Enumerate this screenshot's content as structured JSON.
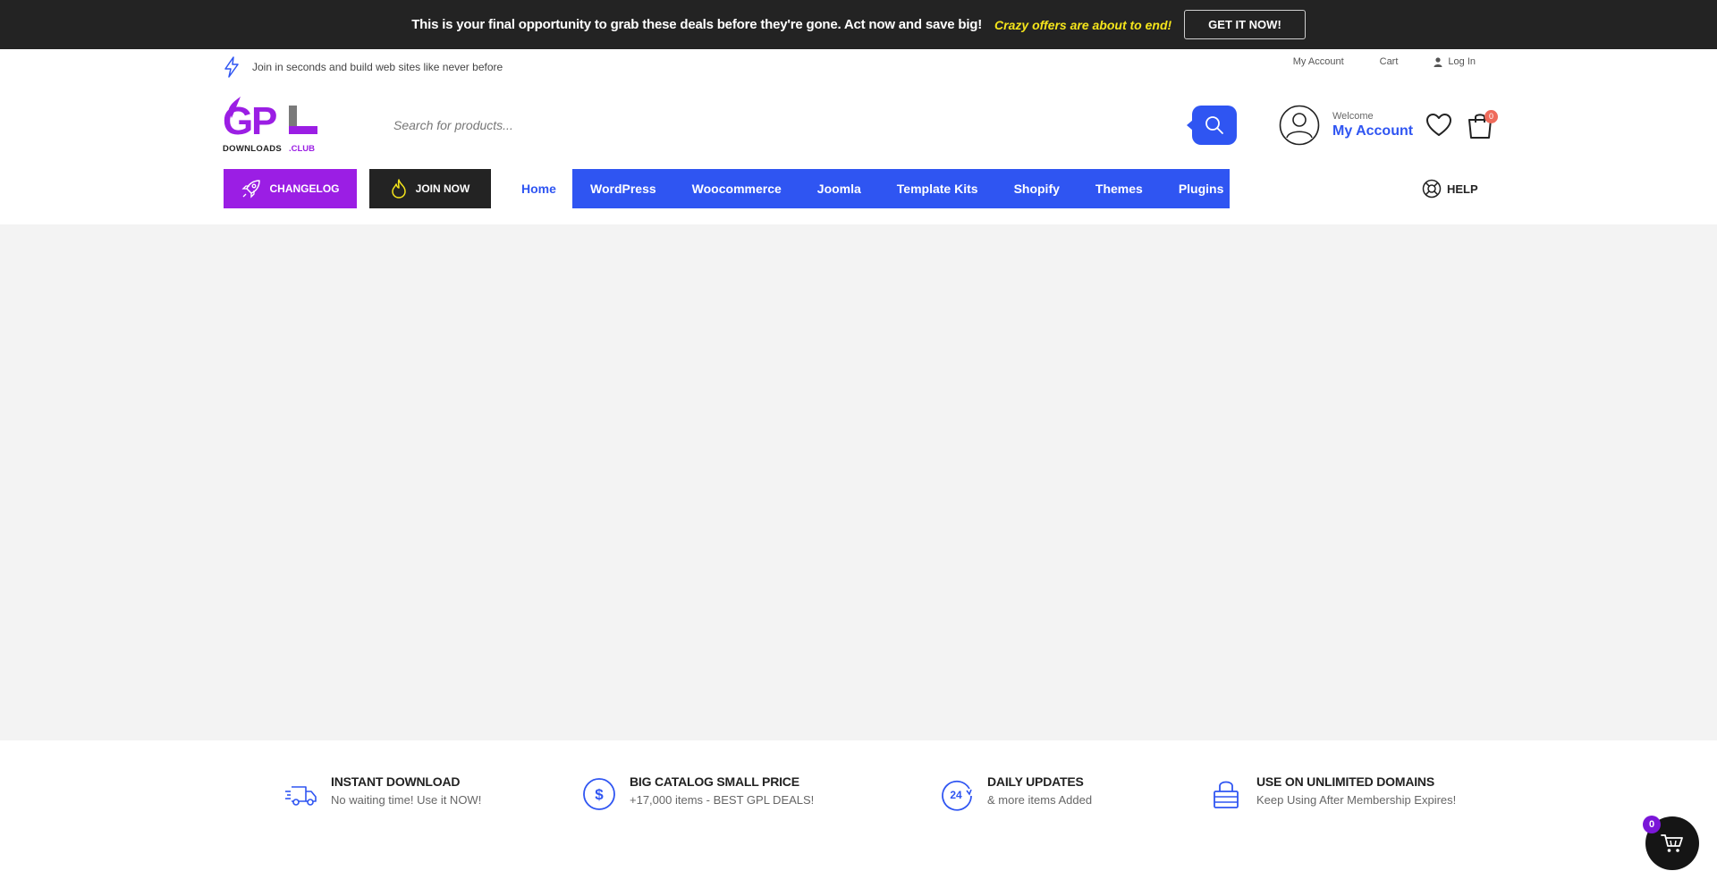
{
  "promo": {
    "message": "This is your final opportunity to grab these deals before they're gone. Act now and save big!",
    "highlight": "Crazy offers are about to end!",
    "cta_label": "GET IT NOW!"
  },
  "utility": {
    "tagline": "Join in seconds and build web sites like never before",
    "my_account": "My Account",
    "cart": "Cart",
    "log_in": "Log In"
  },
  "logo": {
    "main": "GPL",
    "sub": "DOWNLOADS",
    "suffix": ".CLUB"
  },
  "search": {
    "placeholder": "Search for products..."
  },
  "account": {
    "welcome": "Welcome",
    "name": "My Account"
  },
  "cart_count": "0",
  "nav": {
    "changelog": "CHANGELOG",
    "join_now": "JOIN NOW",
    "home": "Home",
    "items": [
      "WordPress",
      "Woocommerce",
      "Joomla",
      "Template Kits",
      "Shopify",
      "Themes",
      "Plugins"
    ],
    "help": "HELP"
  },
  "features": [
    {
      "title": "INSTANT DOWNLOAD",
      "subtitle": "No waiting time! Use it NOW!",
      "icon": "delivery-truck-icon"
    },
    {
      "title": "BIG CATALOG SMALL PRICE",
      "subtitle": "+17,000 items - BEST GPL DEALS!",
      "icon": "dollar-coin-icon"
    },
    {
      "title": "DAILY UPDATES",
      "subtitle": "& more items Added",
      "icon": "24-hours-icon"
    },
    {
      "title": "USE ON UNLIMITED DOMAINS",
      "subtitle": "Keep Using After Membership Expires!",
      "icon": "lock-icon"
    }
  ],
  "floating_cart_count": "0",
  "colors": {
    "accent": "#2f55f2",
    "purple": "#9b1ee4",
    "dark": "#232323",
    "promo_highlight": "#f5e51b"
  }
}
